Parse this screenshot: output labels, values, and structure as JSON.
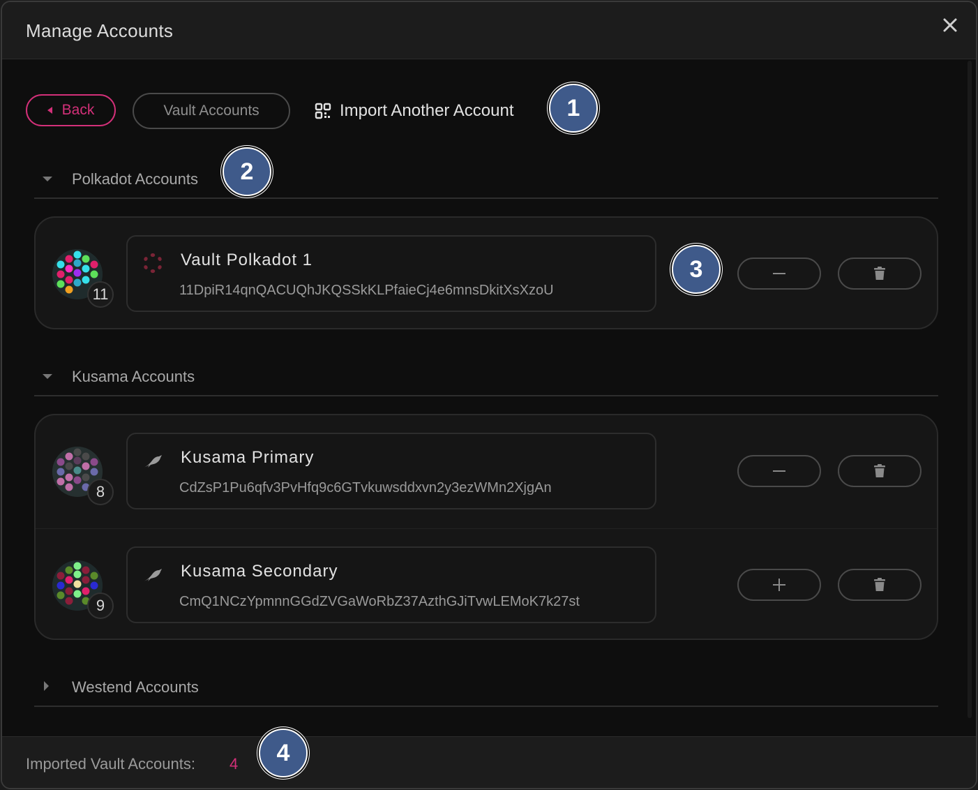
{
  "modal": {
    "title": "Manage Accounts",
    "close_icon": "close-icon"
  },
  "toolbar": {
    "back_label": "Back",
    "vault_label": "Vault Accounts",
    "import_label": "Import Another Account",
    "import_icon": "qr-code-icon"
  },
  "markers": [
    "1",
    "2",
    "3",
    "4"
  ],
  "sections": [
    {
      "label": "Polkadot Accounts",
      "expanded": true,
      "accounts": [
        {
          "name": "Vault Polkadot 1",
          "address": "11DpiR14qnQACUQhJKQSSkKLPfaieCj4e6mnsDkitXsXzoU",
          "index": "11",
          "network_icon": "polkadot-icon",
          "action": "remove"
        }
      ]
    },
    {
      "label": "Kusama Accounts",
      "expanded": true,
      "accounts": [
        {
          "name": "Kusama Primary",
          "address": "CdZsP1Pu6qfv3PvHfq9c6GTvkuwsddxvn2y3ezWMn2XjgAn",
          "index": "8",
          "network_icon": "kusama-icon",
          "action": "remove"
        },
        {
          "name": "Kusama Secondary",
          "address": "CmQ1NCzYpmnnGGdZVGaWoRbZ37AzthGJiTvwLEMoK7k27st",
          "index": "9",
          "network_icon": "kusama-icon",
          "action": "add"
        }
      ]
    },
    {
      "label": "Westend Accounts",
      "expanded": false,
      "accounts": []
    }
  ],
  "footer": {
    "label": "Imported Vault Accounts:",
    "count": "4"
  },
  "colors": {
    "accent": "#d33079",
    "marker": "#3f5a8a",
    "background": "#0e0e0e"
  }
}
